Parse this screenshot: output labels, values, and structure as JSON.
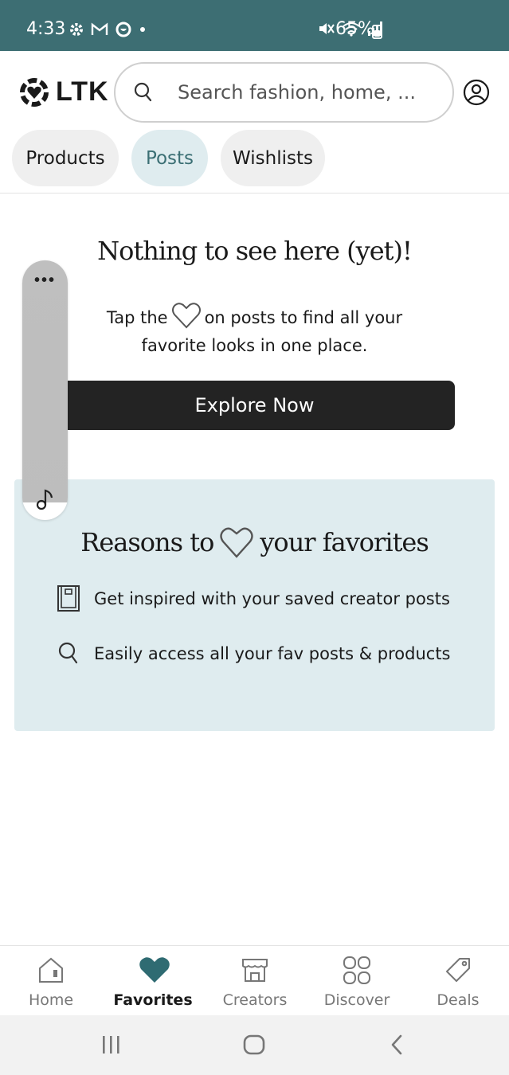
{
  "status_bar": {
    "time": "4:33",
    "battery": "65%"
  },
  "header": {
    "logo_text": "LTK",
    "search_placeholder": "Search fashion, home, ..."
  },
  "tabs": [
    {
      "label": "Products",
      "active": false
    },
    {
      "label": "Posts",
      "active": true
    },
    {
      "label": "Wishlists",
      "active": false
    }
  ],
  "empty_state": {
    "title": "Nothing to see here (yet)!",
    "text_before_heart": "Tap the",
    "text_after_heart": "on posts to find all your",
    "text_line2": "favorite looks in one place.",
    "button_label": "Explore Now"
  },
  "reasons": {
    "title_before_heart": "Reasons to",
    "title_after_heart": "your favorites",
    "items": [
      {
        "icon": "book-icon",
        "text": "Get inspired with your saved creator posts"
      },
      {
        "icon": "search-icon",
        "text": "Easily access all your fav posts & products"
      }
    ]
  },
  "floating_pill": {
    "dots": "•••"
  },
  "bottom_nav": [
    {
      "label": "Home",
      "icon": "home-icon",
      "active": false
    },
    {
      "label": "Favorites",
      "icon": "heart-icon",
      "active": true
    },
    {
      "label": "Creators",
      "icon": "storefront-icon",
      "active": false
    },
    {
      "label": "Discover",
      "icon": "grid-icon",
      "active": false
    },
    {
      "label": "Deals",
      "icon": "tag-icon",
      "active": false
    }
  ],
  "colors": {
    "status_bar": "#3d6e73",
    "accent": "#3b6f74",
    "card_bg": "#dfecef",
    "button_bg": "#232323"
  }
}
